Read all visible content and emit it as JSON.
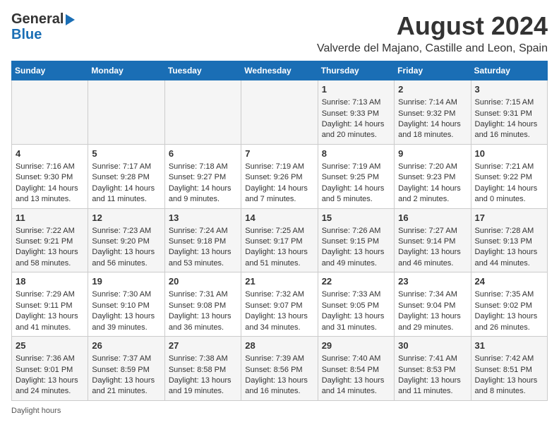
{
  "header": {
    "logo_line1": "General",
    "logo_line2": "Blue",
    "month_title": "August 2024",
    "subtitle": "Valverde del Majano, Castille and Leon, Spain"
  },
  "days_of_week": [
    "Sunday",
    "Monday",
    "Tuesday",
    "Wednesday",
    "Thursday",
    "Friday",
    "Saturday"
  ],
  "weeks": [
    [
      {
        "day": "",
        "info": ""
      },
      {
        "day": "",
        "info": ""
      },
      {
        "day": "",
        "info": ""
      },
      {
        "day": "",
        "info": ""
      },
      {
        "day": "1",
        "info": "Sunrise: 7:13 AM\nSunset: 9:33 PM\nDaylight: 14 hours and 20 minutes."
      },
      {
        "day": "2",
        "info": "Sunrise: 7:14 AM\nSunset: 9:32 PM\nDaylight: 14 hours and 18 minutes."
      },
      {
        "day": "3",
        "info": "Sunrise: 7:15 AM\nSunset: 9:31 PM\nDaylight: 14 hours and 16 minutes."
      }
    ],
    [
      {
        "day": "4",
        "info": "Sunrise: 7:16 AM\nSunset: 9:30 PM\nDaylight: 14 hours and 13 minutes."
      },
      {
        "day": "5",
        "info": "Sunrise: 7:17 AM\nSunset: 9:28 PM\nDaylight: 14 hours and 11 minutes."
      },
      {
        "day": "6",
        "info": "Sunrise: 7:18 AM\nSunset: 9:27 PM\nDaylight: 14 hours and 9 minutes."
      },
      {
        "day": "7",
        "info": "Sunrise: 7:19 AM\nSunset: 9:26 PM\nDaylight: 14 hours and 7 minutes."
      },
      {
        "day": "8",
        "info": "Sunrise: 7:19 AM\nSunset: 9:25 PM\nDaylight: 14 hours and 5 minutes."
      },
      {
        "day": "9",
        "info": "Sunrise: 7:20 AM\nSunset: 9:23 PM\nDaylight: 14 hours and 2 minutes."
      },
      {
        "day": "10",
        "info": "Sunrise: 7:21 AM\nSunset: 9:22 PM\nDaylight: 14 hours and 0 minutes."
      }
    ],
    [
      {
        "day": "11",
        "info": "Sunrise: 7:22 AM\nSunset: 9:21 PM\nDaylight: 13 hours and 58 minutes."
      },
      {
        "day": "12",
        "info": "Sunrise: 7:23 AM\nSunset: 9:20 PM\nDaylight: 13 hours and 56 minutes."
      },
      {
        "day": "13",
        "info": "Sunrise: 7:24 AM\nSunset: 9:18 PM\nDaylight: 13 hours and 53 minutes."
      },
      {
        "day": "14",
        "info": "Sunrise: 7:25 AM\nSunset: 9:17 PM\nDaylight: 13 hours and 51 minutes."
      },
      {
        "day": "15",
        "info": "Sunrise: 7:26 AM\nSunset: 9:15 PM\nDaylight: 13 hours and 49 minutes."
      },
      {
        "day": "16",
        "info": "Sunrise: 7:27 AM\nSunset: 9:14 PM\nDaylight: 13 hours and 46 minutes."
      },
      {
        "day": "17",
        "info": "Sunrise: 7:28 AM\nSunset: 9:13 PM\nDaylight: 13 hours and 44 minutes."
      }
    ],
    [
      {
        "day": "18",
        "info": "Sunrise: 7:29 AM\nSunset: 9:11 PM\nDaylight: 13 hours and 41 minutes."
      },
      {
        "day": "19",
        "info": "Sunrise: 7:30 AM\nSunset: 9:10 PM\nDaylight: 13 hours and 39 minutes."
      },
      {
        "day": "20",
        "info": "Sunrise: 7:31 AM\nSunset: 9:08 PM\nDaylight: 13 hours and 36 minutes."
      },
      {
        "day": "21",
        "info": "Sunrise: 7:32 AM\nSunset: 9:07 PM\nDaylight: 13 hours and 34 minutes."
      },
      {
        "day": "22",
        "info": "Sunrise: 7:33 AM\nSunset: 9:05 PM\nDaylight: 13 hours and 31 minutes."
      },
      {
        "day": "23",
        "info": "Sunrise: 7:34 AM\nSunset: 9:04 PM\nDaylight: 13 hours and 29 minutes."
      },
      {
        "day": "24",
        "info": "Sunrise: 7:35 AM\nSunset: 9:02 PM\nDaylight: 13 hours and 26 minutes."
      }
    ],
    [
      {
        "day": "25",
        "info": "Sunrise: 7:36 AM\nSunset: 9:01 PM\nDaylight: 13 hours and 24 minutes."
      },
      {
        "day": "26",
        "info": "Sunrise: 7:37 AM\nSunset: 8:59 PM\nDaylight: 13 hours and 21 minutes."
      },
      {
        "day": "27",
        "info": "Sunrise: 7:38 AM\nSunset: 8:58 PM\nDaylight: 13 hours and 19 minutes."
      },
      {
        "day": "28",
        "info": "Sunrise: 7:39 AM\nSunset: 8:56 PM\nDaylight: 13 hours and 16 minutes."
      },
      {
        "day": "29",
        "info": "Sunrise: 7:40 AM\nSunset: 8:54 PM\nDaylight: 13 hours and 14 minutes."
      },
      {
        "day": "30",
        "info": "Sunrise: 7:41 AM\nSunset: 8:53 PM\nDaylight: 13 hours and 11 minutes."
      },
      {
        "day": "31",
        "info": "Sunrise: 7:42 AM\nSunset: 8:51 PM\nDaylight: 13 hours and 8 minutes."
      }
    ]
  ],
  "footer": {
    "note": "Daylight hours"
  }
}
